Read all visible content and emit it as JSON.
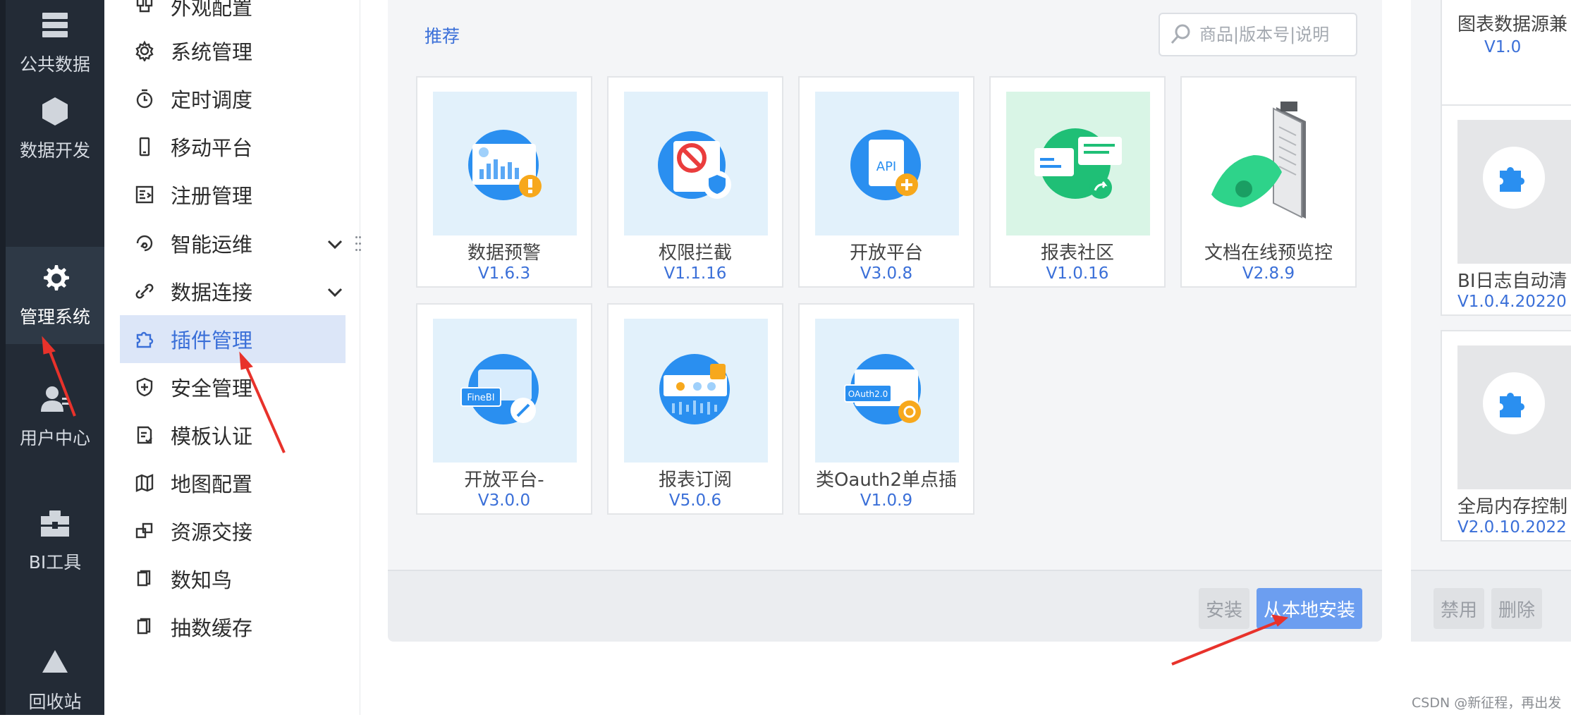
{
  "rail": {
    "items": [
      {
        "label": "公共数据",
        "icon": "database-icon"
      },
      {
        "label": "数据开发",
        "icon": "cube-icon"
      },
      {
        "label": "管理系统",
        "icon": "gear-icon"
      },
      {
        "label": "用户中心",
        "icon": "user-icon"
      },
      {
        "label": "BI工具",
        "icon": "toolbox-icon"
      },
      {
        "label": "回收站",
        "icon": "recycle-icon"
      }
    ],
    "active": "管理系统"
  },
  "menu": {
    "items": [
      {
        "label": "外观配置"
      },
      {
        "label": "系统管理"
      },
      {
        "label": "定时调度"
      },
      {
        "label": "移动平台"
      },
      {
        "label": "注册管理"
      },
      {
        "label": "智能运维"
      },
      {
        "label": "数据连接"
      },
      {
        "label": "插件管理"
      },
      {
        "label": "安全管理"
      },
      {
        "label": "模板认证"
      },
      {
        "label": "地图配置"
      },
      {
        "label": "资源交接"
      },
      {
        "label": "数知鸟"
      },
      {
        "label": "抽数缓存"
      }
    ],
    "active": "插件管理"
  },
  "store": {
    "tab": "推荐",
    "search_placeholder": "商品|版本号|说明",
    "plugins": [
      {
        "name": "数据预警",
        "version": "V1.6.3"
      },
      {
        "name": "权限拦截",
        "version": "V1.1.16"
      },
      {
        "name": "开放平台",
        "version": "V3.0.8"
      },
      {
        "name": "报表社区",
        "version": "V1.0.16"
      },
      {
        "name": "文档在线预览控",
        "version": "V2.8.9"
      },
      {
        "name": "开放平台-",
        "version": "V3.0.0"
      },
      {
        "name": "报表订阅",
        "version": "V5.0.6"
      },
      {
        "name": "类Oauth2单点插",
        "version": "V1.0.9"
      }
    ],
    "install_label": "安装",
    "local_install_label": "从本地安装",
    "fineBI_badge": "FineBI",
    "api_badge": "API",
    "oauth_badge": "OAuth2.0"
  },
  "installed": {
    "plugins": [
      {
        "name": "图表数据源兼",
        "version": "V1.0"
      },
      {
        "name": "BI日志自动清",
        "version": "V1.0.4.20220"
      },
      {
        "name": "全局内存控制",
        "version": "V2.0.10.2022"
      }
    ],
    "disable_label": "禁用",
    "delete_label": "删除"
  },
  "watermark": "CSDN @新征程，再出发",
  "colors": {
    "accent": "#3a6fd8",
    "rail": "#232b36",
    "annotation": "#e8322b"
  }
}
